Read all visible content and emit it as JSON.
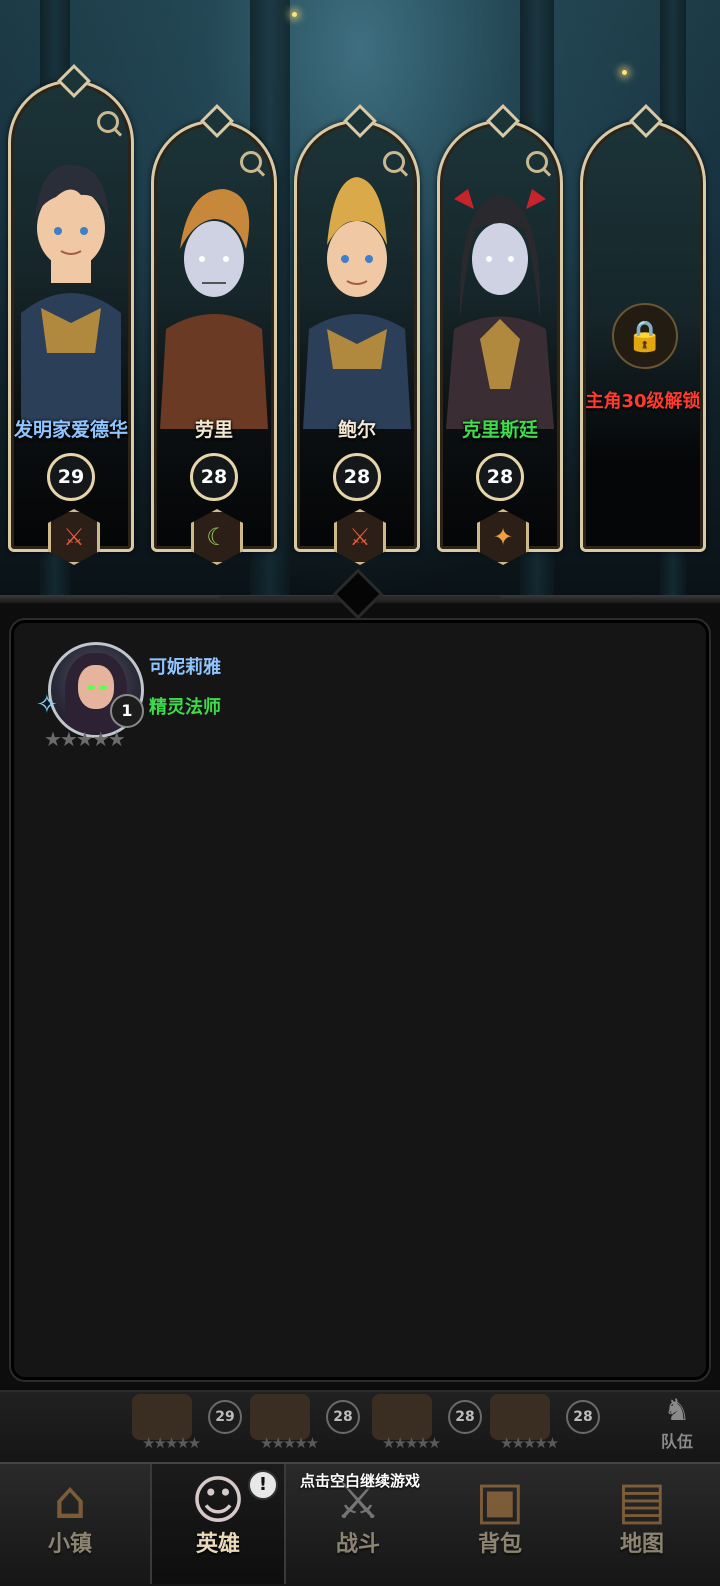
{
  "party": [
    {
      "name": "发明家爱德华",
      "level": "29",
      "class_icon": "sword-icon",
      "name_color": "#8fc6ff"
    },
    {
      "name": "劳里",
      "level": "28",
      "class_icon": "sickle-icon",
      "name_color": "#f1e7d2"
    },
    {
      "name": "鲍尔",
      "level": "28",
      "class_icon": "sword-icon",
      "name_color": "#8fc6ff"
    },
    {
      "name": "克里斯廷",
      "level": "28",
      "class_icon": "holy-star-icon",
      "name_color": "#3ddc4a"
    }
  ],
  "locked_slot": {
    "text": "主角30级解锁"
  },
  "selected_hero": {
    "name": "可妮莉雅",
    "class": "精灵法师",
    "level": "1",
    "stars": 5
  },
  "team_strip": {
    "levels": [
      "29",
      "28",
      "28",
      "28"
    ],
    "team_label": "队伍"
  },
  "hint": "点击空白继续游戏",
  "nav": {
    "town": "小镇",
    "heroes": "英雄",
    "battle": "战斗",
    "bag": "背包",
    "map": "地图",
    "hero_badge": "!"
  },
  "colors": {
    "frame_gold": "#d9c9a4",
    "unlock_red": "#ff3b30",
    "class_green": "#3ddc4a",
    "name_blue": "#8fc6ff"
  }
}
